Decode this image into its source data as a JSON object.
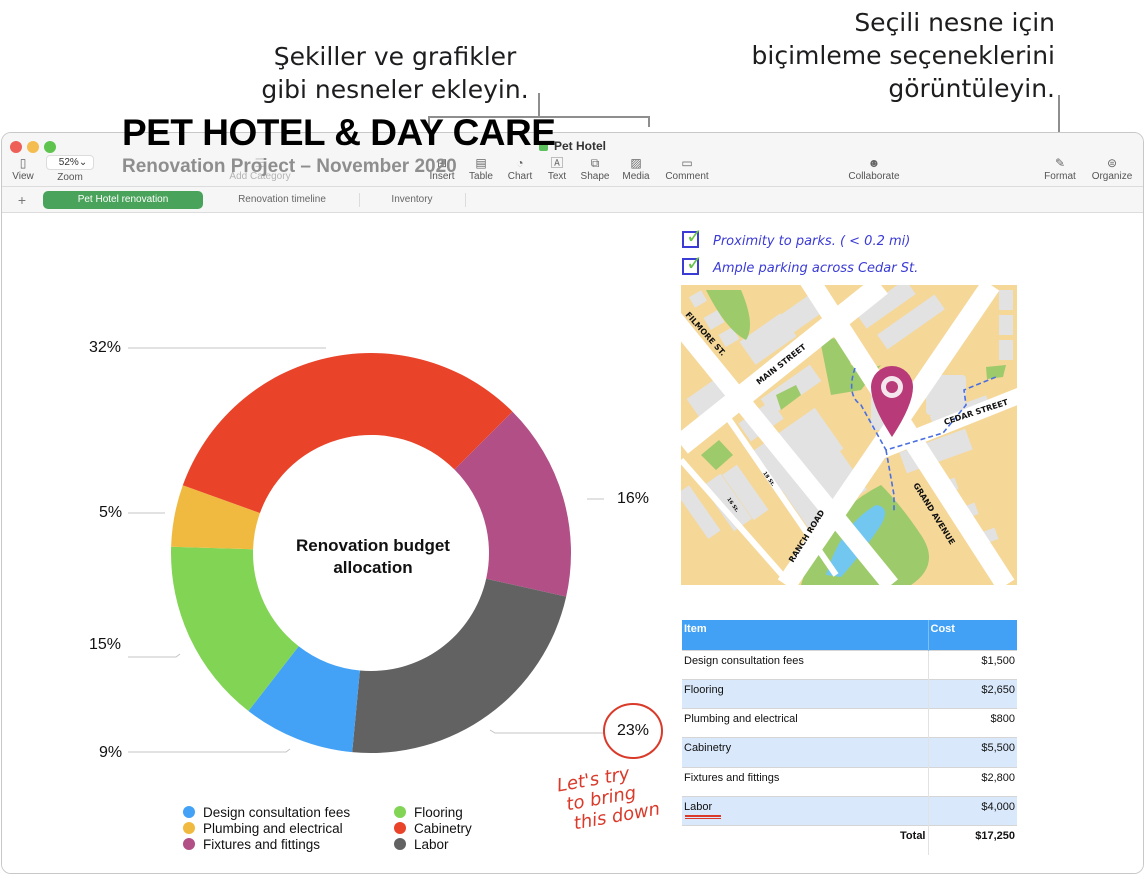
{
  "callouts": {
    "left": [
      "Şekiller ve grafikler",
      "gibi nesneler ekleyin."
    ],
    "right": [
      "Seçili nesne için",
      "biçimleme seçeneklerini",
      "görüntüleyin."
    ]
  },
  "window": {
    "title": "Pet Hotel",
    "traffic_colors": {
      "close": "#ee5f57",
      "minimize": "#f5bd4f",
      "zoom": "#5ec44d"
    }
  },
  "toolbar": {
    "view": "View",
    "zoom_value": "52%",
    "zoom_label": "Zoom",
    "add_category": "Add Category",
    "insert": "Insert",
    "table": "Table",
    "chart": "Chart",
    "text": "Text",
    "shape": "Shape",
    "media": "Media",
    "comment": "Comment",
    "collaborate": "Collaborate",
    "format": "Format",
    "organize": "Organize"
  },
  "tabs": {
    "add": "+",
    "items": [
      {
        "label": "Pet Hotel renovation",
        "active": true
      },
      {
        "label": "Renovation timeline",
        "active": false
      },
      {
        "label": "Inventory",
        "active": false
      }
    ]
  },
  "document": {
    "title": "PET HOTEL & DAY CARE",
    "subtitle": "Renovation Project – November 2020",
    "checklist": [
      "Proximity to parks. ( < 0.2 mi)",
      "Ample parking across  Cedar St."
    ],
    "handwritten_note": [
      "Let's try",
      "to bring",
      "this down"
    ],
    "map": {
      "streets": [
        "FILMORE ST.",
        "MAIN STREET",
        "CEDAR STREET",
        "GRAND AVENUE",
        "RANCH ROAD",
        "18 St.",
        "16 St."
      ],
      "pin_color": "#b83a78"
    }
  },
  "chart_data": {
    "type": "pie",
    "variant": "donut",
    "title": "Renovation budget allocation",
    "start_angle_deg": 45,
    "direction": "clockwise",
    "series": [
      {
        "name": "Fixtures and fittings",
        "value": 16,
        "color": "#b24f86"
      },
      {
        "name": "Labor",
        "value": 23,
        "color": "#626262"
      },
      {
        "name": "Design consultation fees",
        "value": 9,
        "color": "#43a2f6"
      },
      {
        "name": "Flooring",
        "value": 15,
        "color": "#82d455"
      },
      {
        "name": "Plumbing and electrical",
        "value": 5,
        "color": "#f0ba41"
      },
      {
        "name": "Cabinetry",
        "value": 32,
        "color": "#e94329"
      }
    ],
    "data_labels": [
      "16%",
      "23%",
      "9%",
      "15%",
      "5%",
      "32%"
    ],
    "legend": {
      "placement": "bottom",
      "columns": [
        [
          "Design consultation fees",
          "Plumbing and electrical",
          "Fixtures and fittings"
        ],
        [
          "Flooring",
          "Cabinetry",
          "Labor"
        ]
      ]
    },
    "highlighted_label": "23%"
  },
  "budget_table": {
    "headers": [
      "Item",
      "Cost"
    ],
    "rows": [
      {
        "item": "Design consultation fees",
        "cost": "$1,500"
      },
      {
        "item": "Flooring",
        "cost": "$2,650"
      },
      {
        "item": "Plumbing and electrical",
        "cost": "$800"
      },
      {
        "item": "Cabinetry",
        "cost": "$5,500"
      },
      {
        "item": "Fixtures and fittings",
        "cost": "$2,800"
      },
      {
        "item": "Labor",
        "cost": "$4,000"
      }
    ],
    "total_label": "Total",
    "total_value": "$17,250"
  }
}
